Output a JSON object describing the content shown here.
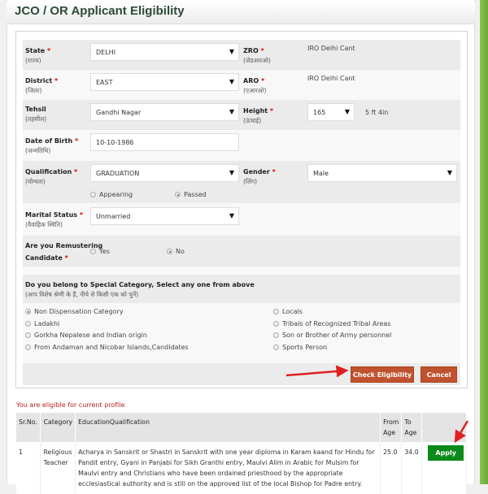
{
  "title": "JCO / OR Applicant Eligibility",
  "form": {
    "state": {
      "label": "State",
      "hindi": "(राज्य)",
      "value": "DELHI"
    },
    "zro": {
      "label": "ZRO",
      "hindi": "(जेडआरओ)",
      "value": "IRO Delhi Cant"
    },
    "district": {
      "label": "District",
      "hindi": "(जिला)",
      "value": "EAST"
    },
    "aro": {
      "label": "ARO",
      "hindi": "(एआरओ)",
      "value": "IRO Delhi Cant"
    },
    "tehsil": {
      "label": "Tehsil",
      "hindi": "(तहसील)",
      "value": "Gandhi Nagar"
    },
    "height": {
      "label": "Height",
      "hindi": "(ऊंचाई)",
      "value": "165",
      "converted": "5 ft 4in"
    },
    "dob": {
      "label": "Date of Birth",
      "hindi": "(जन्मतिथि)",
      "value": "10-10-1986"
    },
    "qualification": {
      "label": "Qualification",
      "hindi": "(योग्यता)",
      "value": "GRADUATION",
      "options": [
        {
          "label": "Appearing",
          "checked": false
        },
        {
          "label": "Passed",
          "checked": true
        }
      ]
    },
    "gender": {
      "label": "Gender",
      "hindi": "(लिंग)",
      "value": "Male"
    },
    "marital": {
      "label": "Marital Status",
      "hindi": "(वैवाहिक स्थिति)",
      "value": "Unmarried"
    },
    "remustering": {
      "label1": "Are you Remustering",
      "label2": "Candidate",
      "options": [
        {
          "label": "Yes",
          "checked": false
        },
        {
          "label": "No",
          "checked": true
        }
      ]
    },
    "special": {
      "question": "Do you belong to Special Category, Select any one from above",
      "hindi": "(आप विशेष श्रेणी के हैं, नीचे से किसी एक को चुनें)",
      "left": [
        {
          "label": "Non Dispensation Category",
          "checked": true
        },
        {
          "label": "Ladakhi",
          "checked": false
        },
        {
          "label": "Gorkha Nepalese and Indian origin",
          "checked": false
        },
        {
          "label": "From Andaman and Nicobar Islands,Candidates",
          "checked": false
        }
      ],
      "right": [
        {
          "label": "Locals",
          "checked": false
        },
        {
          "label": "Tribals of Recognized Tribal Areas",
          "checked": false
        },
        {
          "label": "Son or Brother of Army personnel",
          "checked": false
        },
        {
          "label": "Sports Person",
          "checked": false
        }
      ]
    },
    "check_label": "Check Eligibility",
    "cancel_label": "Cancel",
    "required_mark": "*"
  },
  "result": {
    "message": "You are eligible for current profile",
    "headers": [
      "Sr.No.",
      "Category",
      "EducationQualification",
      "From Age",
      "To Age",
      ""
    ],
    "rows": [
      {
        "sr": "1",
        "category": "Religious Teacher",
        "education": "Acharya in Sanskrit or Shastri in Sanskrit with one year diploma in Karam kaand for Hindu for Pandit entry, Gyani in Panjabi for Sikh Granthi entry, Maulvi Alim in Arabic for Mulsim for Maulvi entry and Christians who have been ordained priesthood by the appropriate ecclesiastical authority and is still on the approved list of the local Bishop for Padre entry.",
        "from": "25.0",
        "to": "34.0",
        "action": "Apply"
      }
    ]
  },
  "colors": {
    "accent_button": "#c0522f",
    "apply_button": "#0a8a1a",
    "arrow": "#e02020"
  }
}
